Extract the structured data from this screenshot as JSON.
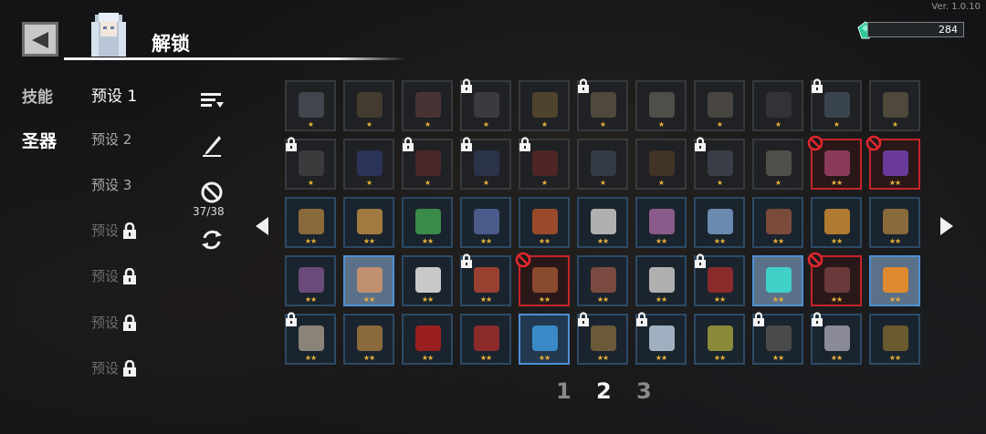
{
  "version": "Ver. 1.0.10",
  "header": {
    "title": "解锁"
  },
  "currency": {
    "amount": "284"
  },
  "categories": [
    {
      "label": "技能",
      "active": false
    },
    {
      "label": "圣器",
      "active": true
    }
  ],
  "presets": [
    {
      "label": "预设 1",
      "state": "active"
    },
    {
      "label": "预设 2",
      "state": "normal"
    },
    {
      "label": "预设 3",
      "state": "normal"
    },
    {
      "label": "预设",
      "state": "locked"
    },
    {
      "label": "预设",
      "state": "locked"
    },
    {
      "label": "预设",
      "state": "locked"
    },
    {
      "label": "预设",
      "state": "locked"
    }
  ],
  "tools": {
    "ban_count": "37/38",
    "icons": [
      "sort-icon",
      "quill-icon",
      "ban-icon",
      "refresh-icon"
    ]
  },
  "pagination": {
    "pages": [
      "1",
      "2",
      "3"
    ],
    "current": "2"
  },
  "grid": {
    "rows": [
      [
        {
          "color": "#6a7080",
          "stars": "★",
          "locked": false,
          "banned": false,
          "style": "dim"
        },
        {
          "color": "#6e5a3e",
          "stars": "★",
          "locked": false,
          "banned": false,
          "style": "dim"
        },
        {
          "color": "#7a4a4a",
          "stars": "★",
          "locked": false,
          "banned": false,
          "style": "dim"
        },
        {
          "color": "#5a5a62",
          "stars": "★",
          "locked": true,
          "banned": false,
          "style": "dim"
        },
        {
          "color": "#8a6c3c",
          "stars": "★",
          "locked": false,
          "banned": false,
          "style": "dim"
        },
        {
          "color": "#8a7a5a",
          "stars": "★",
          "locked": true,
          "banned": false,
          "style": "dim"
        },
        {
          "color": "#8a8478",
          "stars": "★",
          "locked": false,
          "banned": false,
          "style": "dim"
        },
        {
          "color": "#7a7066",
          "stars": "★",
          "locked": false,
          "banned": false,
          "style": "dim"
        },
        {
          "color": "#4a4a50",
          "stars": "★",
          "locked": false,
          "banned": false,
          "style": "dim"
        },
        {
          "color": "#5a6e86",
          "stars": "★",
          "locked": true,
          "banned": false,
          "style": "dim"
        },
        {
          "color": "#8a7a5a",
          "stars": "★",
          "locked": false,
          "banned": false,
          "style": "dim"
        }
      ],
      [
        {
          "color": "#5a5a5a",
          "stars": "★",
          "locked": true,
          "banned": false,
          "style": "dim"
        },
        {
          "color": "#3a4a9a",
          "stars": "★",
          "locked": false,
          "banned": false,
          "style": "dim"
        },
        {
          "color": "#7a3030",
          "stars": "★",
          "locked": true,
          "banned": false,
          "style": "dim"
        },
        {
          "color": "#3a4a7a",
          "stars": "★",
          "locked": true,
          "banned": false,
          "style": "dim"
        },
        {
          "color": "#8a2a2a",
          "stars": "★",
          "locked": true,
          "banned": false,
          "style": "dim"
        },
        {
          "color": "#4a5a70",
          "stars": "★",
          "locked": false,
          "banned": false,
          "style": "dim"
        },
        {
          "color": "#6a4a2a",
          "stars": "★",
          "locked": false,
          "banned": false,
          "style": "dim"
        },
        {
          "color": "#5a6070",
          "stars": "★",
          "locked": true,
          "banned": false,
          "style": "dim"
        },
        {
          "color": "#8a8478",
          "stars": "★",
          "locked": false,
          "banned": false,
          "style": "dim"
        },
        {
          "color": "#8a3a5a",
          "stars": "★★",
          "locked": false,
          "banned": true,
          "style": "ban"
        },
        {
          "color": "#6a3a9a",
          "stars": "★★",
          "locked": false,
          "banned": true,
          "style": "ban"
        }
      ],
      [
        {
          "color": "#8a6a3a",
          "stars": "★★",
          "locked": false,
          "banned": false,
          "style": "rare"
        },
        {
          "color": "#a07a40",
          "stars": "★★",
          "locked": false,
          "banned": false,
          "style": "rare"
        },
        {
          "color": "#3a8a4a",
          "stars": "★★",
          "locked": false,
          "banned": false,
          "style": "rare"
        },
        {
          "color": "#4a5a8a",
          "stars": "★★",
          "locked": false,
          "banned": false,
          "style": "rare"
        },
        {
          "color": "#9a4a2a",
          "stars": "★★",
          "locked": false,
          "banned": false,
          "style": "rare"
        },
        {
          "color": "#b0b0b0",
          "stars": "★★",
          "locked": false,
          "banned": false,
          "style": "rare"
        },
        {
          "color": "#8a5a8a",
          "stars": "★★",
          "locked": false,
          "banned": false,
          "style": "rare"
        },
        {
          "color": "#6a8ab0",
          "stars": "★★",
          "locked": false,
          "banned": false,
          "style": "rare"
        },
        {
          "color": "#7a4a3a",
          "stars": "★★",
          "locked": false,
          "banned": false,
          "style": "rare"
        },
        {
          "color": "#b07a30",
          "stars": "★★",
          "locked": false,
          "banned": false,
          "style": "rare"
        },
        {
          "color": "#8a6a3a",
          "stars": "★★",
          "locked": false,
          "banned": false,
          "style": "rare"
        }
      ],
      [
        {
          "color": "#6a4a7a",
          "stars": "★★",
          "locked": false,
          "banned": false,
          "style": "rare"
        },
        {
          "color": "#c09070",
          "stars": "★★",
          "locked": false,
          "banned": false,
          "style": "sel"
        },
        {
          "color": "#c8c8c8",
          "stars": "★★",
          "locked": false,
          "banned": false,
          "style": "rare"
        },
        {
          "color": "#9a4030",
          "stars": "★★",
          "locked": true,
          "banned": false,
          "style": "rare"
        },
        {
          "color": "#8a4a30",
          "stars": "★★",
          "locked": false,
          "banned": true,
          "style": "ban"
        },
        {
          "color": "#7a4a40",
          "stars": "★★",
          "locked": false,
          "banned": false,
          "style": "rare"
        },
        {
          "color": "#b0b0b0",
          "stars": "★★",
          "locked": false,
          "banned": false,
          "style": "rare"
        },
        {
          "color": "#8a2a2a",
          "stars": "★★",
          "locked": true,
          "banned": false,
          "style": "rare"
        },
        {
          "color": "#40d0c8",
          "stars": "★★",
          "locked": false,
          "banned": false,
          "style": "sel"
        },
        {
          "color": "#6a3a3a",
          "stars": "★★",
          "locked": false,
          "banned": true,
          "style": "ban"
        },
        {
          "color": "#e08a30",
          "stars": "★★",
          "locked": false,
          "banned": false,
          "style": "sel"
        }
      ],
      [
        {
          "color": "#8a8478",
          "stars": "★★",
          "locked": true,
          "banned": false,
          "style": "rare"
        },
        {
          "color": "#8a6a3a",
          "stars": "★★",
          "locked": false,
          "banned": false,
          "style": "rare"
        },
        {
          "color": "#9a2020",
          "stars": "★★",
          "locked": false,
          "banned": false,
          "style": "rare"
        },
        {
          "color": "#8a2a2a",
          "stars": "★★",
          "locked": false,
          "banned": false,
          "style": "rare"
        },
        {
          "color": "#3a8ac8",
          "stars": "★★",
          "locked": false,
          "banned": false,
          "style": "sel2"
        },
        {
          "color": "#6a5a3a",
          "stars": "★★",
          "locked": true,
          "banned": false,
          "style": "rare"
        },
        {
          "color": "#a0b0c0",
          "stars": "★★",
          "locked": true,
          "banned": false,
          "style": "rare"
        },
        {
          "color": "#8a8a3a",
          "stars": "★★",
          "locked": false,
          "banned": false,
          "style": "rare"
        },
        {
          "color": "#4a4a4a",
          "stars": "★★",
          "locked": true,
          "banned": false,
          "style": "rare"
        },
        {
          "color": "#8a8a9a",
          "stars": "★★",
          "locked": true,
          "banned": false,
          "style": "rare"
        },
        {
          "color": "#6a5a30",
          "stars": "★★",
          "locked": false,
          "banned": false,
          "style": "rare"
        }
      ]
    ]
  }
}
